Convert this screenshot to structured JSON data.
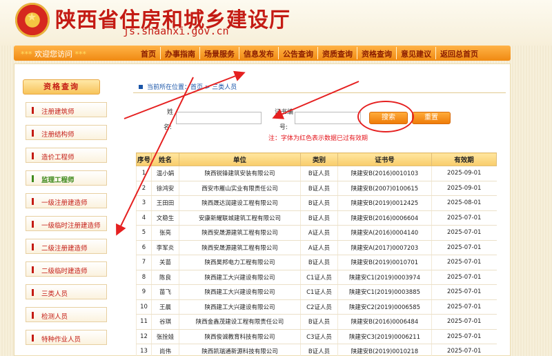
{
  "header": {
    "title": "陕西省住房和城乡建设厅",
    "domain": "js.shaanxi.gov.cn"
  },
  "welcome": {
    "stars_left": "***",
    "text": "欢迎您访问",
    "stars_right": "***"
  },
  "nav": [
    "首页",
    "办事指南",
    "场景服务",
    "信息发布",
    "公告查询",
    "资质查询",
    "资格查询",
    "意见建议",
    "返回总首页"
  ],
  "sidebar": {
    "title": "资格查询",
    "items": [
      {
        "label": "注册建筑师",
        "active": false
      },
      {
        "label": "注册结构师",
        "active": false
      },
      {
        "label": "造价工程师",
        "active": false
      },
      {
        "label": "监理工程师",
        "active": true
      },
      {
        "label": "一级注册建造师",
        "active": false
      },
      {
        "label": "一级临时注册建造师",
        "active": false
      },
      {
        "label": "二级注册建造师",
        "active": false
      },
      {
        "label": "二级临时建造师",
        "active": false
      },
      {
        "label": "三类人员",
        "active": false
      },
      {
        "label": "检测人员",
        "active": false
      },
      {
        "label": "特种作业人员",
        "active": false
      }
    ]
  },
  "breadcrumb": {
    "prefix": "当前所在位置：",
    "home": "首页",
    "sep": " > ",
    "current": "三类人员"
  },
  "search": {
    "name_label_1": "姓",
    "name_label_2": "名:",
    "cert_label_1": "证书编",
    "cert_label_2": "号:",
    "name_value": "",
    "cert_value": "",
    "search_button": "搜索",
    "reset_button": "重置",
    "note": "注：字体为红色表示数据已过有效期"
  },
  "table": {
    "headers": [
      "序号",
      "姓名",
      "单位",
      "类别",
      "证书号",
      "有效期"
    ],
    "rows": [
      [
        "1",
        "温小娟",
        "陕西锐锋建筑安装有限公司",
        "B证人员",
        "陕建安B(2016)0010103",
        "2025-09-01"
      ],
      [
        "2",
        "徐鸿安",
        "西安市雁山实业有限责任公司",
        "B证人员",
        "陕建安B(2007)0100615",
        "2025-09-01"
      ],
      [
        "3",
        "王田田",
        "陕西晟达润建设工程有限公司",
        "B证人员",
        "陕建安B(2019)0012425",
        "2025-08-01"
      ],
      [
        "4",
        "文稳生",
        "安康新耀联城建筑工程有限公司",
        "B证人员",
        "陕建安B(2016)0006604",
        "2025-07-01"
      ],
      [
        "5",
        "张亮",
        "陕西安晟源建筑工程有限公司",
        "A证人员",
        "陕建安A(2016)0004140",
        "2025-07-01"
      ],
      [
        "6",
        "李军炎",
        "陕西安晟源建筑工程有限公司",
        "A证人员",
        "陕建安A(2017)0007203",
        "2025-07-01"
      ],
      [
        "7",
        "关苗",
        "陕西昊邦电力工程有限公司",
        "B证人员",
        "陕建安B(2019)0010701",
        "2025-07-01"
      ],
      [
        "8",
        "陈良",
        "陕西建工大兴建设有限公司",
        "C1证人员",
        "陕建安C1(2019)0003974",
        "2025-07-01"
      ],
      [
        "9",
        "苗飞",
        "陕西建工大兴建设有限公司",
        "C1证人员",
        "陕建安C1(2019)0003885",
        "2025-07-01"
      ],
      [
        "10",
        "王晨",
        "陕西建工大兴建设有限公司",
        "C2证人员",
        "陕建安C2(2019)0006585",
        "2025-07-01"
      ],
      [
        "11",
        "谷琪",
        "陕西金鑫茂建设工程有限责任公司",
        "B证人员",
        "陕建安B(2016)0006484",
        "2025-07-01"
      ],
      [
        "12",
        "张拴娃",
        "陕西俊诚教育科技有限公司",
        "C3证人员",
        "陕建安C3(2019)0006211",
        "2025-07-01"
      ],
      [
        "13",
        "尚伟",
        "陕西凯瑞通新源科技有限公司",
        "B证人员",
        "陕建安B(2019)0010218",
        "2025-07-01"
      ]
    ]
  },
  "colors": {
    "accent": "#f08a12",
    "brand_red": "#c41b14",
    "annotation_red": "#e52020"
  }
}
